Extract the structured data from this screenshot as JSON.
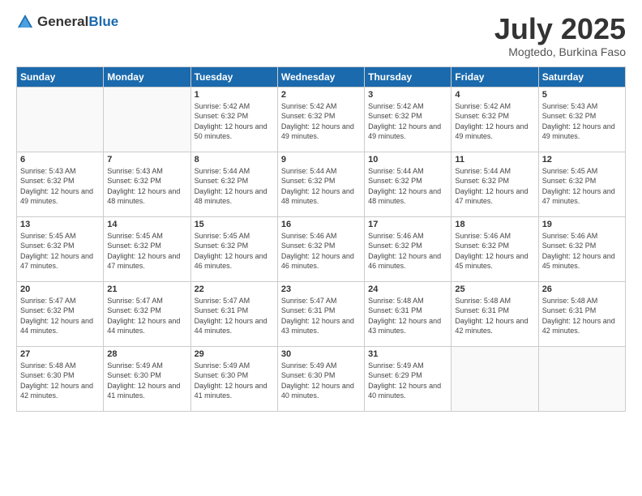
{
  "header": {
    "logo_general": "General",
    "logo_blue": "Blue",
    "main_title": "July 2025",
    "subtitle": "Mogtedo, Burkina Faso"
  },
  "calendar": {
    "days_of_week": [
      "Sunday",
      "Monday",
      "Tuesday",
      "Wednesday",
      "Thursday",
      "Friday",
      "Saturday"
    ],
    "weeks": [
      [
        {
          "day": "",
          "info": ""
        },
        {
          "day": "",
          "info": ""
        },
        {
          "day": "1",
          "info": "Sunrise: 5:42 AM\nSunset: 6:32 PM\nDaylight: 12 hours and 50 minutes."
        },
        {
          "day": "2",
          "info": "Sunrise: 5:42 AM\nSunset: 6:32 PM\nDaylight: 12 hours and 49 minutes."
        },
        {
          "day": "3",
          "info": "Sunrise: 5:42 AM\nSunset: 6:32 PM\nDaylight: 12 hours and 49 minutes."
        },
        {
          "day": "4",
          "info": "Sunrise: 5:42 AM\nSunset: 6:32 PM\nDaylight: 12 hours and 49 minutes."
        },
        {
          "day": "5",
          "info": "Sunrise: 5:43 AM\nSunset: 6:32 PM\nDaylight: 12 hours and 49 minutes."
        }
      ],
      [
        {
          "day": "6",
          "info": "Sunrise: 5:43 AM\nSunset: 6:32 PM\nDaylight: 12 hours and 49 minutes."
        },
        {
          "day": "7",
          "info": "Sunrise: 5:43 AM\nSunset: 6:32 PM\nDaylight: 12 hours and 48 minutes."
        },
        {
          "day": "8",
          "info": "Sunrise: 5:44 AM\nSunset: 6:32 PM\nDaylight: 12 hours and 48 minutes."
        },
        {
          "day": "9",
          "info": "Sunrise: 5:44 AM\nSunset: 6:32 PM\nDaylight: 12 hours and 48 minutes."
        },
        {
          "day": "10",
          "info": "Sunrise: 5:44 AM\nSunset: 6:32 PM\nDaylight: 12 hours and 48 minutes."
        },
        {
          "day": "11",
          "info": "Sunrise: 5:44 AM\nSunset: 6:32 PM\nDaylight: 12 hours and 47 minutes."
        },
        {
          "day": "12",
          "info": "Sunrise: 5:45 AM\nSunset: 6:32 PM\nDaylight: 12 hours and 47 minutes."
        }
      ],
      [
        {
          "day": "13",
          "info": "Sunrise: 5:45 AM\nSunset: 6:32 PM\nDaylight: 12 hours and 47 minutes."
        },
        {
          "day": "14",
          "info": "Sunrise: 5:45 AM\nSunset: 6:32 PM\nDaylight: 12 hours and 47 minutes."
        },
        {
          "day": "15",
          "info": "Sunrise: 5:45 AM\nSunset: 6:32 PM\nDaylight: 12 hours and 46 minutes."
        },
        {
          "day": "16",
          "info": "Sunrise: 5:46 AM\nSunset: 6:32 PM\nDaylight: 12 hours and 46 minutes."
        },
        {
          "day": "17",
          "info": "Sunrise: 5:46 AM\nSunset: 6:32 PM\nDaylight: 12 hours and 46 minutes."
        },
        {
          "day": "18",
          "info": "Sunrise: 5:46 AM\nSunset: 6:32 PM\nDaylight: 12 hours and 45 minutes."
        },
        {
          "day": "19",
          "info": "Sunrise: 5:46 AM\nSunset: 6:32 PM\nDaylight: 12 hours and 45 minutes."
        }
      ],
      [
        {
          "day": "20",
          "info": "Sunrise: 5:47 AM\nSunset: 6:32 PM\nDaylight: 12 hours and 44 minutes."
        },
        {
          "day": "21",
          "info": "Sunrise: 5:47 AM\nSunset: 6:32 PM\nDaylight: 12 hours and 44 minutes."
        },
        {
          "day": "22",
          "info": "Sunrise: 5:47 AM\nSunset: 6:31 PM\nDaylight: 12 hours and 44 minutes."
        },
        {
          "day": "23",
          "info": "Sunrise: 5:47 AM\nSunset: 6:31 PM\nDaylight: 12 hours and 43 minutes."
        },
        {
          "day": "24",
          "info": "Sunrise: 5:48 AM\nSunset: 6:31 PM\nDaylight: 12 hours and 43 minutes."
        },
        {
          "day": "25",
          "info": "Sunrise: 5:48 AM\nSunset: 6:31 PM\nDaylight: 12 hours and 42 minutes."
        },
        {
          "day": "26",
          "info": "Sunrise: 5:48 AM\nSunset: 6:31 PM\nDaylight: 12 hours and 42 minutes."
        }
      ],
      [
        {
          "day": "27",
          "info": "Sunrise: 5:48 AM\nSunset: 6:30 PM\nDaylight: 12 hours and 42 minutes."
        },
        {
          "day": "28",
          "info": "Sunrise: 5:49 AM\nSunset: 6:30 PM\nDaylight: 12 hours and 41 minutes."
        },
        {
          "day": "29",
          "info": "Sunrise: 5:49 AM\nSunset: 6:30 PM\nDaylight: 12 hours and 41 minutes."
        },
        {
          "day": "30",
          "info": "Sunrise: 5:49 AM\nSunset: 6:30 PM\nDaylight: 12 hours and 40 minutes."
        },
        {
          "day": "31",
          "info": "Sunrise: 5:49 AM\nSunset: 6:29 PM\nDaylight: 12 hours and 40 minutes."
        },
        {
          "day": "",
          "info": ""
        },
        {
          "day": "",
          "info": ""
        }
      ]
    ]
  }
}
